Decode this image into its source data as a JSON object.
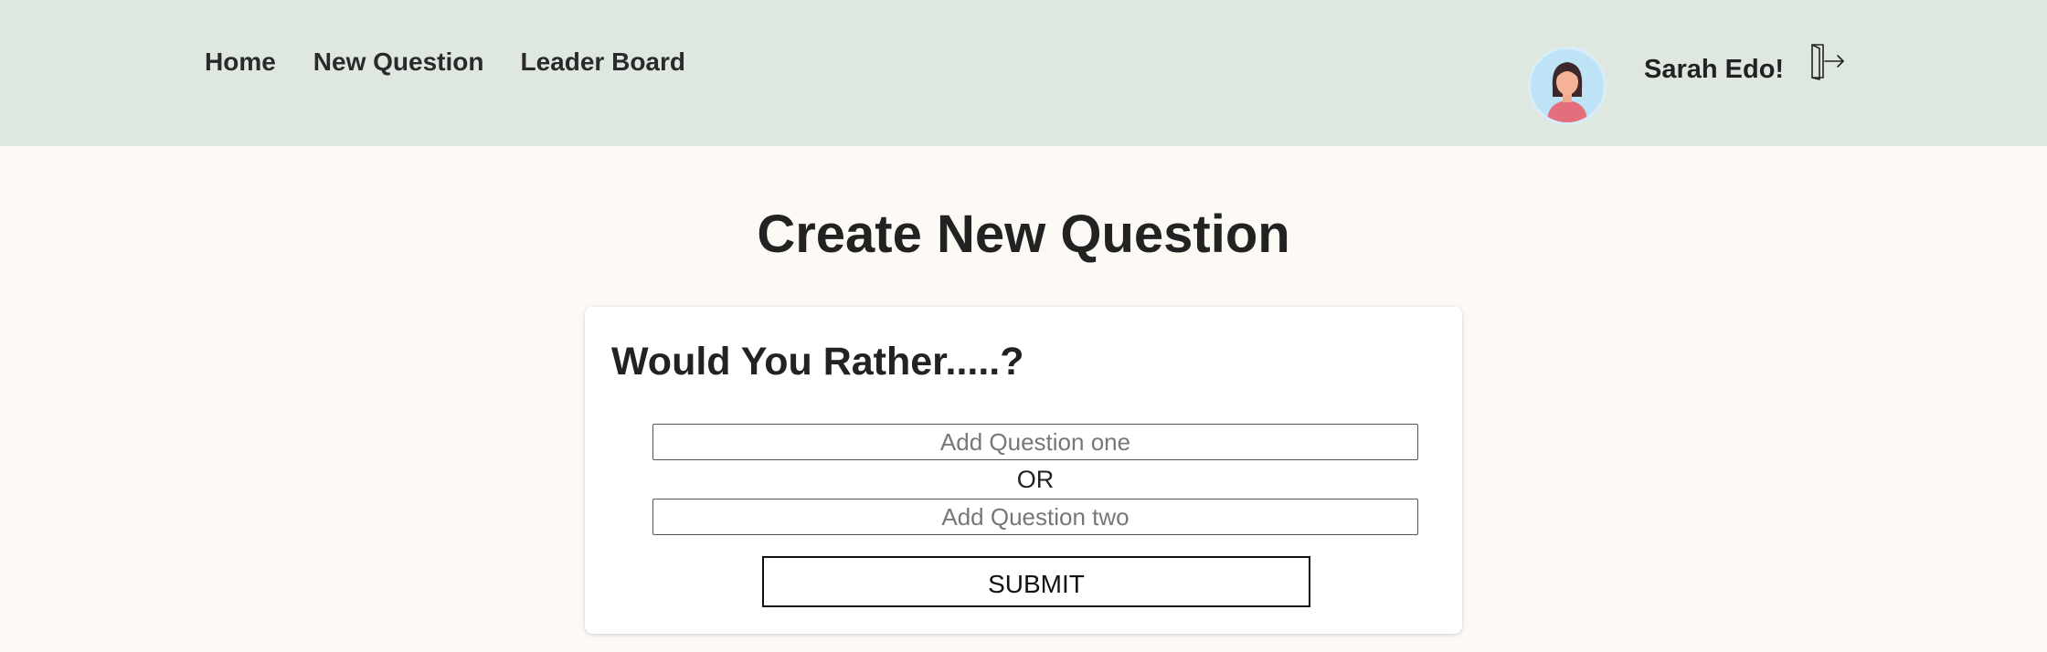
{
  "nav": {
    "items": [
      {
        "label": "Home"
      },
      {
        "label": "New Question"
      },
      {
        "label": "Leader Board"
      }
    ]
  },
  "user": {
    "greeting": "Sarah Edo!",
    "avatar_icon": "woman-avatar-icon",
    "logout_icon": "logout-door-icon"
  },
  "main": {
    "title": "Create New Question"
  },
  "form": {
    "heading": "Would You Rather.....?",
    "option_one": {
      "value": "",
      "placeholder": "Add Question one"
    },
    "separator": "OR",
    "option_two": {
      "value": "",
      "placeholder": "Add Question two"
    },
    "submit_label": "SUBMIT"
  },
  "colors": {
    "header_bg": "#dfe8e0",
    "page_bg": "#fdfaf5",
    "card_bg": "#ffffff",
    "avatar_bg": "#bfe3f6"
  }
}
